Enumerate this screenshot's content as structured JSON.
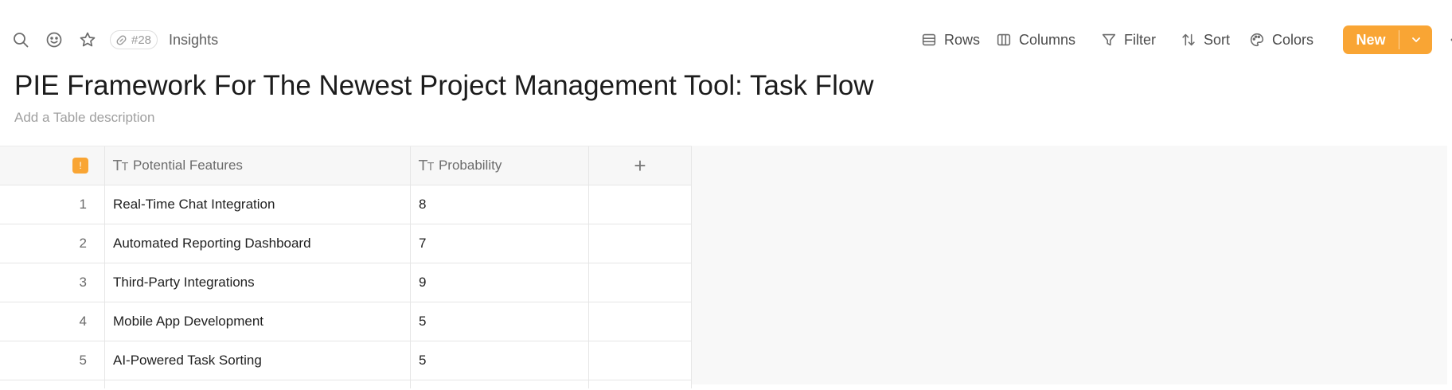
{
  "toolbar": {
    "id_badge": "#28",
    "breadcrumb": "Insights",
    "buttons": {
      "rows": "Rows",
      "columns": "Columns",
      "filter": "Filter",
      "sort": "Sort",
      "colors": "Colors",
      "new": "New"
    },
    "accent_color": "#f9a534"
  },
  "page": {
    "title": "PIE Framework For The Newest Project Management Tool: Task Flow",
    "description_placeholder": "Add a Table description"
  },
  "table": {
    "columns": [
      "Potential Features",
      "Probability"
    ],
    "rows": [
      {
        "num": "1",
        "feature": "Real-Time Chat Integration",
        "probability": "8"
      },
      {
        "num": "2",
        "feature": "Automated Reporting Dashboard",
        "probability": "7"
      },
      {
        "num": "3",
        "feature": "Third-Party Integrations",
        "probability": "9"
      },
      {
        "num": "4",
        "feature": "Mobile App Development",
        "probability": "5"
      },
      {
        "num": "5",
        "feature": "AI-Powered Task Sorting",
        "probability": "5"
      }
    ]
  }
}
